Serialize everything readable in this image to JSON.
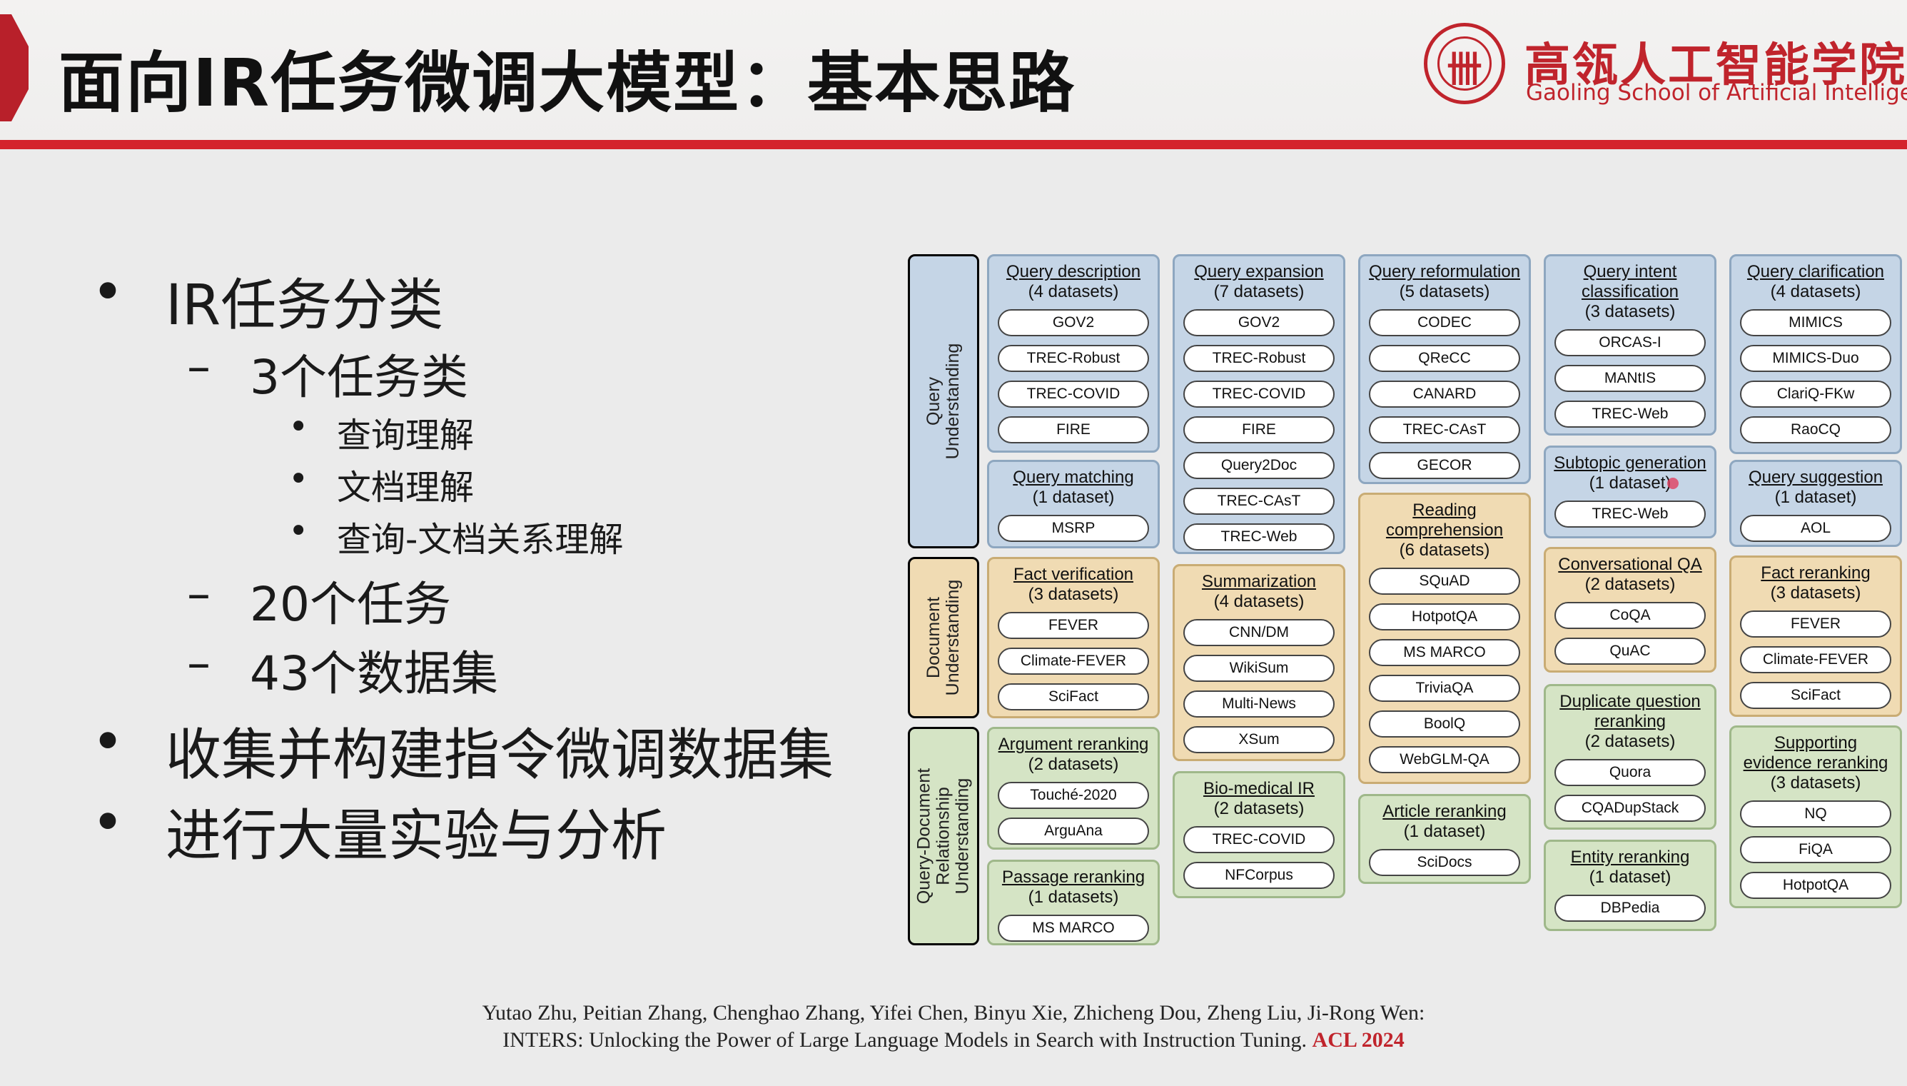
{
  "header": {
    "title": "面向IR任务微调大模型：基本思路",
    "logo_cn": "高瓴人工智能学院",
    "logo_en": "Gaoling School of Artificial Intelligence",
    "logo_seal": "卌"
  },
  "bullets": [
    {
      "level": 1,
      "marker": "•",
      "text": "IR任务分类"
    },
    {
      "level": 2,
      "marker": "–",
      "text": "3个任务类"
    },
    {
      "level": 3,
      "marker": "•",
      "text": "查询理解"
    },
    {
      "level": 3,
      "marker": "•",
      "text": "文档理解"
    },
    {
      "level": 3,
      "marker": "•",
      "text": "查询-文档关系理解"
    },
    {
      "level": 2,
      "marker": "–",
      "text": "20个任务"
    },
    {
      "level": 2,
      "marker": "–",
      "text": "43个数据集"
    },
    {
      "level": 1,
      "marker": "•",
      "text": "收集并构建指令微调数据集"
    },
    {
      "level": 1,
      "marker": "•",
      "text": "进行大量实验与分析"
    }
  ],
  "diagram": {
    "categories": [
      {
        "id": "q",
        "label": [
          "Query",
          "Understanding"
        ]
      },
      {
        "id": "d",
        "label": [
          "Document",
          "Understanding"
        ]
      },
      {
        "id": "r",
        "label": [
          "Query-Document",
          "Relationship",
          "Understanding"
        ]
      }
    ],
    "tasks": [
      {
        "id": "qdesc",
        "group": "q",
        "title": [
          "Query description"
        ],
        "count": "(4 datasets)",
        "datasets": [
          "GOV2",
          "TREC-Robust",
          "TREC-COVID",
          "FIRE"
        ]
      },
      {
        "id": "qmatch",
        "group": "q",
        "title": [
          "Query matching"
        ],
        "count": "(1 dataset)",
        "datasets": [
          "MSRP"
        ]
      },
      {
        "id": "qexp",
        "group": "q",
        "title": [
          "Query expansion"
        ],
        "count": "(7 datasets)",
        "datasets": [
          "GOV2",
          "TREC-Robust",
          "TREC-COVID",
          "FIRE",
          "Query2Doc",
          "TREC-CAsT",
          "TREC-Web"
        ]
      },
      {
        "id": "qref",
        "group": "q",
        "title": [
          "Query reformulation"
        ],
        "count": "(5 datasets)",
        "datasets": [
          "CODEC",
          "QReCC",
          "CANARD",
          "TREC-CAsT",
          "GECOR"
        ]
      },
      {
        "id": "qint",
        "group": "q",
        "title": [
          "Query intent",
          "classification"
        ],
        "count": "(3 datasets)",
        "datasets": [
          "ORCAS-I",
          "MANtIS",
          "TREC-Web"
        ]
      },
      {
        "id": "subtopic",
        "group": "q",
        "title": [
          "Subtopic generation"
        ],
        "count": "(1 dataset)",
        "datasets": [
          "TREC-Web"
        ]
      },
      {
        "id": "qclar",
        "group": "q",
        "title": [
          "Query clarification"
        ],
        "count": "(4 datasets)",
        "datasets": [
          "MIMICS",
          "MIMICS-Duo",
          "ClariQ-FKw",
          "RaoCQ"
        ]
      },
      {
        "id": "qsugg",
        "group": "q",
        "title": [
          "Query suggestion"
        ],
        "count": "(1 dataset)",
        "datasets": [
          "AOL"
        ]
      },
      {
        "id": "factver",
        "group": "d",
        "title": [
          "Fact verification"
        ],
        "count": "(3 datasets)",
        "datasets": [
          "FEVER",
          "Climate-FEVER",
          "SciFact"
        ]
      },
      {
        "id": "summ",
        "group": "d",
        "title": [
          "Summarization"
        ],
        "count": "(4 datasets)",
        "datasets": [
          "CNN/DM",
          "WikiSum",
          "Multi-News",
          "XSum"
        ]
      },
      {
        "id": "reading",
        "group": "d",
        "title": [
          "Reading",
          "comprehension"
        ],
        "count": "(6 datasets)",
        "datasets": [
          "SQuAD",
          "HotpotQA",
          "MS MARCO",
          "TriviaQA",
          "BoolQ",
          "WebGLM-QA"
        ]
      },
      {
        "id": "convqa",
        "group": "d",
        "title": [
          "Conversational QA"
        ],
        "count": "(2 datasets)",
        "datasets": [
          "CoQA",
          "QuAC"
        ]
      },
      {
        "id": "argrr",
        "group": "r",
        "title": [
          "Argument reranking"
        ],
        "count": "(2 datasets)",
        "datasets": [
          "Touché-2020",
          "ArguAna"
        ]
      },
      {
        "id": "passrr",
        "group": "r",
        "title": [
          "Passage reranking"
        ],
        "count": "(1 datasets)",
        "datasets": [
          "MS MARCO"
        ]
      },
      {
        "id": "biomed",
        "group": "r",
        "title": [
          "Bio-medical IR"
        ],
        "count": "(2 datasets)",
        "datasets": [
          "TREC-COVID",
          "NFCorpus"
        ]
      },
      {
        "id": "artrr",
        "group": "r",
        "title": [
          "Article reranking"
        ],
        "count": "(1 dataset)",
        "datasets": [
          "SciDocs"
        ]
      },
      {
        "id": "dupq",
        "group": "r",
        "title": [
          "Duplicate question",
          "reranking"
        ],
        "count": "(2 datasets)",
        "datasets": [
          "Quora",
          "CQADupStack"
        ]
      },
      {
        "id": "entrr",
        "group": "r",
        "title": [
          "Entity reranking"
        ],
        "count": "(1 dataset)",
        "datasets": [
          "DBPedia"
        ]
      },
      {
        "id": "factrr",
        "group": "d",
        "title": [
          "Fact reranking"
        ],
        "count": "(3 datasets)",
        "datasets": [
          "FEVER",
          "Climate-FEVER",
          "SciFact"
        ]
      },
      {
        "id": "suprr",
        "group": "r",
        "title": [
          "Supporting",
          "evidence reranking"
        ],
        "count": "(3 datasets)",
        "datasets": [
          "NQ",
          "FiQA",
          "HotpotQA"
        ]
      }
    ]
  },
  "citation": {
    "line1": "Yutao Zhu, Peitian Zhang, Chenghao Zhang, Yifei Chen, Binyu Xie, Zhicheng Dou, Zheng Liu, Ji-Rong Wen:",
    "line2": "INTERS: Unlocking the Power of Large Language Models in Search with Instruction Tuning. ",
    "venue": "ACL 2024"
  }
}
